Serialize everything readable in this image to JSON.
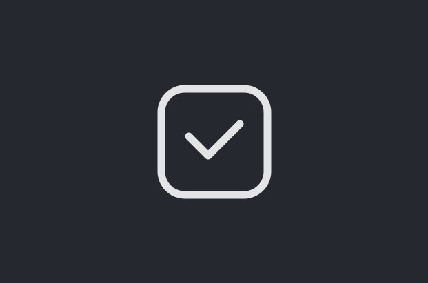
{
  "theme": {
    "background": "#25282e",
    "icon_color": "#e3e4e6"
  },
  "checkbox": {
    "icon": "checkbox-checked-icon",
    "checked": true
  }
}
